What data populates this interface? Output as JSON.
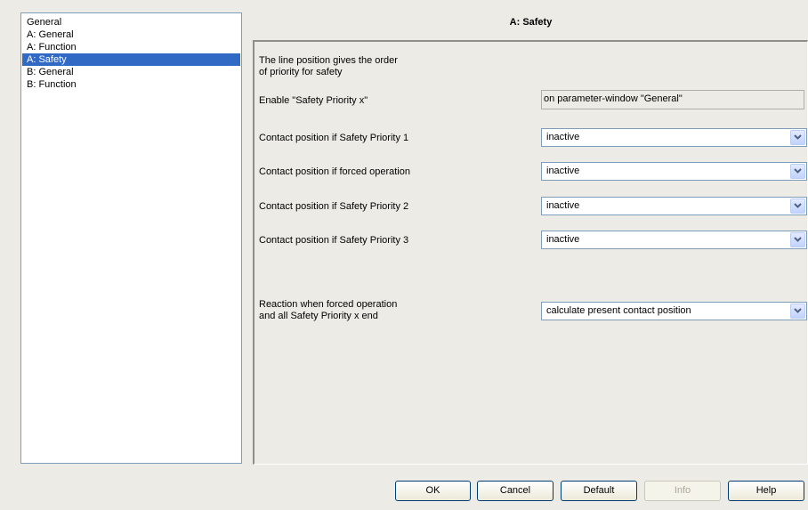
{
  "nav": {
    "items": [
      {
        "label": "General"
      },
      {
        "label": "A: General"
      },
      {
        "label": "A: Function"
      },
      {
        "label": "A: Safety"
      },
      {
        "label": "B: General"
      },
      {
        "label": "B: Function"
      }
    ],
    "selected": "A: Safety"
  },
  "panel": {
    "title": "A: Safety",
    "info_line1": "The line position gives the order",
    "info_line2": "of priority for safety",
    "enable": {
      "label": "Enable \"Safety Priority x\"",
      "value": "on parameter-window \"General\""
    },
    "params": [
      {
        "label": "Contact position if Safety Priority 1",
        "value": "inactive"
      },
      {
        "label": "Contact position if forced operation",
        "value": "inactive"
      },
      {
        "label": "Contact position if Safety Priority 2",
        "value": "inactive"
      },
      {
        "label": "Contact position if Safety Priority 3",
        "value": "inactive"
      }
    ],
    "reaction": {
      "label_line1": "Reaction when forced operation",
      "label_line2": "and all Safety Priority x end",
      "value": "calculate present contact position"
    }
  },
  "buttons": {
    "ok": "OK",
    "cancel": "Cancel",
    "default": "Default",
    "info": "Info",
    "help": "Help"
  },
  "colors": {
    "selection": "#316ac5",
    "background": "#ecebe5",
    "field_border": "#7f9db9"
  }
}
